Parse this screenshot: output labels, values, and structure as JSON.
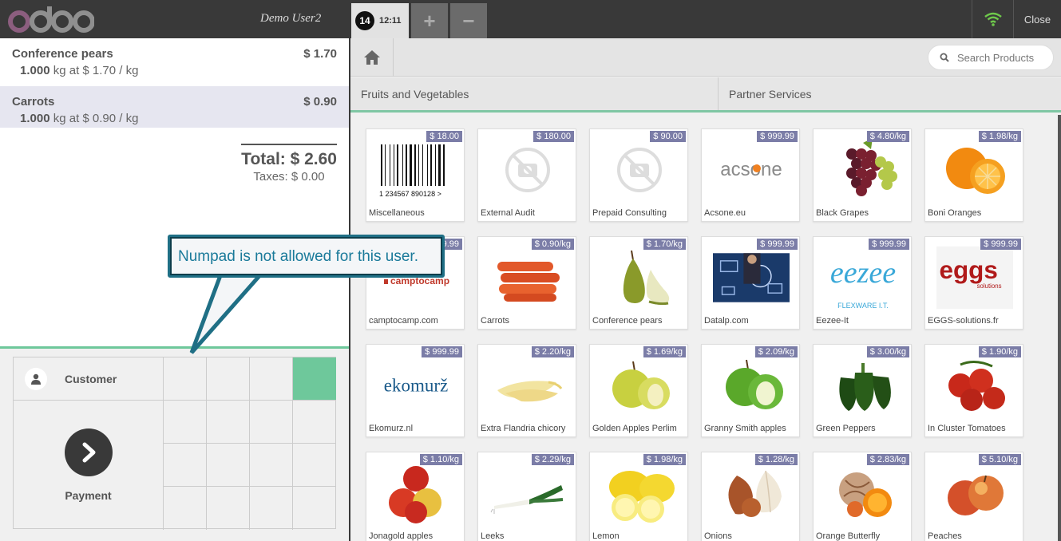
{
  "header": {
    "user": "Demo User2",
    "order_number": "14",
    "order_time": "12:11",
    "add_label": "+",
    "remove_label": "−",
    "close_label": "Close"
  },
  "order": {
    "lines": [
      {
        "name": "Conference pears",
        "price": "$ 1.70",
        "qty": "1.000",
        "unit_info": "kg at $ 1.70 / kg"
      },
      {
        "name": "Carrots",
        "price": "$ 0.90",
        "qty": "1.000",
        "unit_info": "kg at $ 0.90 / kg"
      }
    ],
    "total": "Total: $ 2.60",
    "taxes": "Taxes: $ 0.00"
  },
  "actions": {
    "customer_label": "Customer",
    "payment_label": "Payment"
  },
  "callout": {
    "text": "Numpad is not allowed for this user."
  },
  "products_bar": {
    "search_placeholder": "Search Products",
    "categories": [
      "Fruits and Vegetables",
      "Partner Services"
    ]
  },
  "products": [
    {
      "name": "Miscellaneous",
      "price": "$ 18.00",
      "icon": "barcode-icon"
    },
    {
      "name": "External Audit",
      "price": "$ 180.00",
      "icon": "no-photo-icon"
    },
    {
      "name": "Prepaid Consulting",
      "price": "$ 90.00",
      "icon": "no-photo-icon"
    },
    {
      "name": "Acsone.eu",
      "price": "$ 999.99",
      "icon": "acsone-logo"
    },
    {
      "name": "Black Grapes",
      "price": "$ 4.80/kg",
      "icon": "grapes-icon"
    },
    {
      "name": "Boni Oranges",
      "price": "$ 1.98/kg",
      "icon": "orange-icon"
    },
    {
      "name": "camptocamp.com",
      "price": "$ 999.99",
      "icon": "camptocamp-logo"
    },
    {
      "name": "Carrots",
      "price": "$ 0.90/kg",
      "icon": "carrot-icon"
    },
    {
      "name": "Conference pears",
      "price": "$ 1.70/kg",
      "icon": "pear-icon"
    },
    {
      "name": "Datalp.com",
      "price": "$ 999.99",
      "icon": "datalp-image"
    },
    {
      "name": "Eezee-It",
      "price": "$ 999.99",
      "icon": "eezee-logo"
    },
    {
      "name": "EGGS-solutions.fr",
      "price": "$ 999.99",
      "icon": "eggs-logo"
    },
    {
      "name": "Ekomurz.nl",
      "price": "$ 999.99",
      "icon": "ekomurz-logo"
    },
    {
      "name": "Extra Flandria chicory",
      "price": "$ 2.20/kg",
      "icon": "chicory-icon"
    },
    {
      "name": "Golden Apples Perlim",
      "price": "$ 1.69/kg",
      "icon": "golden-apple-icon"
    },
    {
      "name": "Granny Smith apples",
      "price": "$ 2.09/kg",
      "icon": "green-apple-icon"
    },
    {
      "name": "Green Peppers",
      "price": "$ 3.00/kg",
      "icon": "pepper-icon"
    },
    {
      "name": "In Cluster Tomatoes",
      "price": "$ 1.90/kg",
      "icon": "tomato-icon"
    },
    {
      "name": "Jonagold apples",
      "price": "$ 1.10/kg",
      "icon": "red-apple-icon"
    },
    {
      "name": "Leeks",
      "price": "$ 2.29/kg",
      "icon": "leek-icon"
    },
    {
      "name": "Lemon",
      "price": "$ 1.98/kg",
      "icon": "lemon-icon"
    },
    {
      "name": "Onions",
      "price": "$ 1.28/kg",
      "icon": "onion-icon"
    },
    {
      "name": "Orange Butterfly",
      "price": "$ 2.83/kg",
      "icon": "orange-butterfly-icon"
    },
    {
      "name": "Peaches",
      "price": "$ 5.10/kg",
      "icon": "peach-icon"
    }
  ],
  "logo_texts": {
    "barcode_digits": "1 234567 890128 >",
    "acsone": "acsone",
    "camptocamp": "camptocamp",
    "eezee": "eezee",
    "eezee_sub": "FLEXWARE I.T.",
    "eggs": "eggs",
    "eggs_sub": "solutions",
    "ekomurz": "ekomurž"
  },
  "colors": {
    "topbar": "#393939",
    "accent_green": "#6ec89b",
    "price_tag": "#7b7da7",
    "callout_border": "#1f6f85",
    "callout_text": "#1a7a9a"
  }
}
